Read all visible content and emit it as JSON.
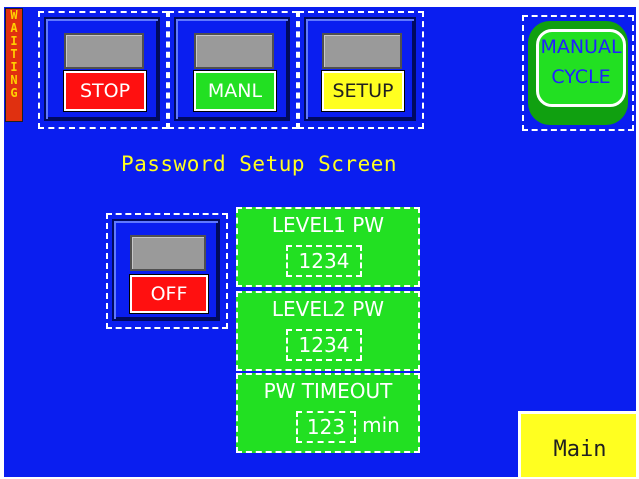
{
  "status": {
    "text": "WAITING",
    "letters": [
      "W",
      "A",
      "I",
      "T",
      "I",
      "N",
      "G"
    ]
  },
  "header_buttons": [
    {
      "label": "STOP",
      "color": "#ff1010"
    },
    {
      "label": "MANL",
      "color": "#22e022"
    },
    {
      "label": "SETUP",
      "color": "#ffff20"
    }
  ],
  "manual_cycle": {
    "line1": "MANUAL",
    "line2": "CYCLE"
  },
  "title": "Password Setup Screen",
  "password_toggle": {
    "label": "OFF",
    "color": "#ff1010"
  },
  "fields": [
    {
      "caption": "LEVEL1 PW",
      "value": "1234",
      "unit": ""
    },
    {
      "caption": "LEVEL2 PW",
      "value": "1234",
      "unit": ""
    },
    {
      "caption": "PW TIMEOUT",
      "value": "123",
      "unit": "min"
    }
  ],
  "main_button": "Main",
  "colors": {
    "background": "#0a1ef0",
    "green": "#22e022",
    "yellow": "#ffff20",
    "red": "#ff1010"
  }
}
